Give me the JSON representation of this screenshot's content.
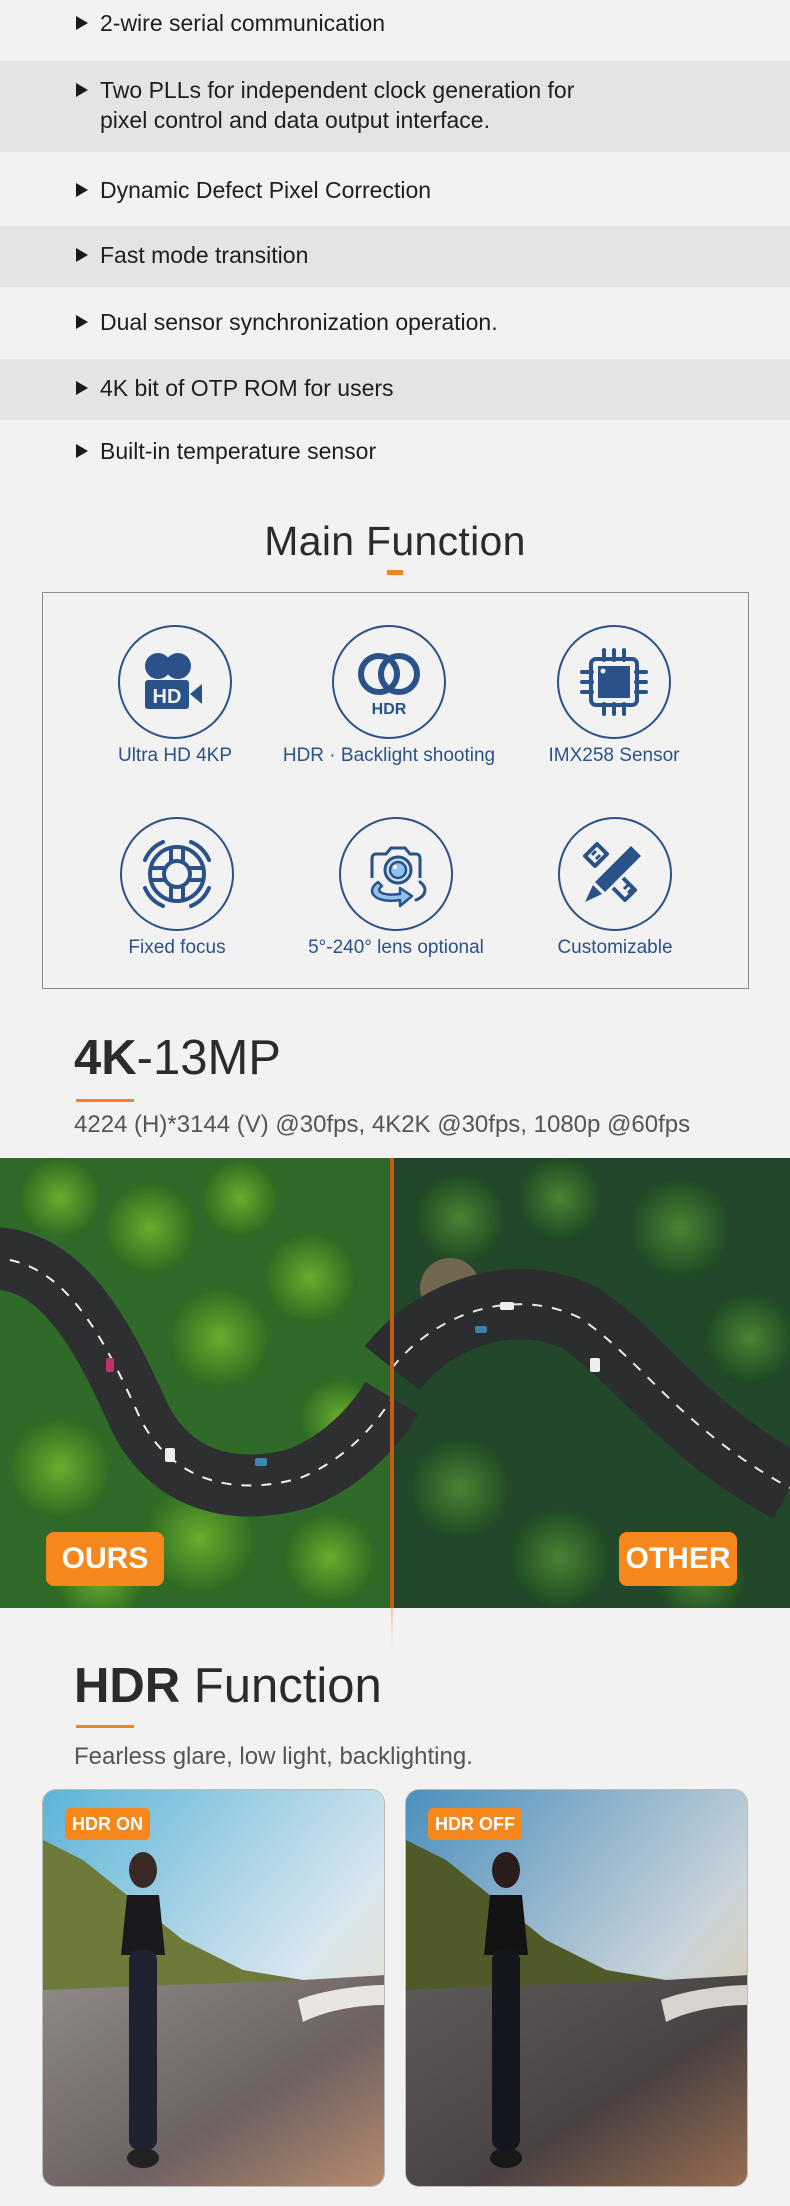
{
  "features": [
    {
      "text": "2-wire serial communication",
      "alt": false
    },
    {
      "text": " Two PLLs for independent clock generation for\n pixel control and data output interface.",
      "alt": true
    },
    {
      "text": "Dynamic Defect Pixel Correction",
      "alt": false
    },
    {
      "text": "Fast mode transition",
      "alt": true
    },
    {
      "text": " Dual sensor synchronization operation.",
      "alt": false
    },
    {
      "text": "4K bit of OTP ROM for users",
      "alt": true
    },
    {
      "text": "Built-in temperature sensor",
      "alt": false
    }
  ],
  "main_function": {
    "title": "Main Function",
    "items": [
      {
        "label": "Ultra HD 4KP",
        "icon": "hd-camera-icon"
      },
      {
        "label": "HDR · Backlight shooting",
        "icon": "hdr-icon"
      },
      {
        "label": "IMX258 Sensor",
        "icon": "chip-icon"
      },
      {
        "label": "Fixed focus",
        "icon": "lifebuoy-focus-icon"
      },
      {
        "label": "5°-240° lens optional",
        "icon": "camera-rotate-icon"
      },
      {
        "label": "Customizable",
        "icon": "pencil-ruler-icon"
      }
    ]
  },
  "resolution": {
    "title_bold": "4K",
    "title_light": "-13MP",
    "subtitle": "4224 (H)*3144 (V) @30fps, 4K2K @30fps, 1080p @60fps",
    "left_badge": "OURS",
    "right_badge": "OTHER"
  },
  "hdr": {
    "title_bold": "HDR",
    "title_light": " Function",
    "subtitle": "Fearless glare, low light, backlighting.",
    "left_badge": "HDR ON",
    "right_badge": "HDR OFF"
  },
  "colors": {
    "accent": "#f0851e",
    "icon_blue": "#2a5288",
    "badge_orange": "#f6871c",
    "row_alt": "#e4e4e4",
    "background": "#f2f2f2"
  }
}
